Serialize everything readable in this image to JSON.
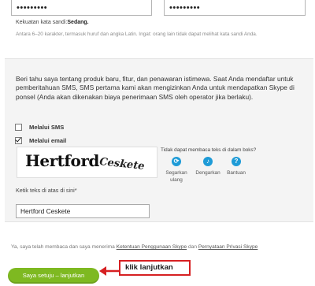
{
  "password": {
    "value_masked": "•••••••••",
    "confirm_masked": "•••••••••",
    "strength_label": "Kekuatan kata sandi:",
    "strength_value": "Sedang.",
    "hint": "Antara 6–20 karakter, termasuk huruf dan angka Latin. Ingat: orang lain tidak dapat melihat kata sandi Anda."
  },
  "marketing": {
    "offer_text": "Beri tahu saya tentang produk baru, fitur, dan penawaran istimewa. Saat Anda mendaftar untuk pemberitahuan SMS, SMS pertama kami akan mengizinkan Anda untuk mendapatkan Skype di ponsel (Anda akan dikenakan biaya penerimaan SMS oleh operator jika berlaku).",
    "sms_label": "Melalui SMS",
    "sms_checked": false,
    "email_label": "Melalui email",
    "email_checked": true
  },
  "captcha": {
    "word1": "Hertford",
    "word2": "Ceskete",
    "cant_read": "Tidak dapat membaca teks di dalam boks?",
    "refresh_label": "Segarkan ulang",
    "listen_label": "Dengarkan",
    "help_label": "Bantuan",
    "input_label": "Ketik teks di atas di sini*",
    "input_value": "Hertford Ceskete"
  },
  "terms": {
    "prefix": "Ya, saya telah membaca dan saya menerima",
    "tou_link": "Ketentuan Penggunaan Skype",
    "and": "dan",
    "privacy_link": "Pernyataan Privasi Skype"
  },
  "agree_button": "Saya setuju – lanjutkan",
  "annotation": "klik lanjutkan",
  "colors": {
    "accent_green": "#7eb921",
    "skype_blue": "#1e9bd7",
    "callout_red": "#d62022"
  }
}
